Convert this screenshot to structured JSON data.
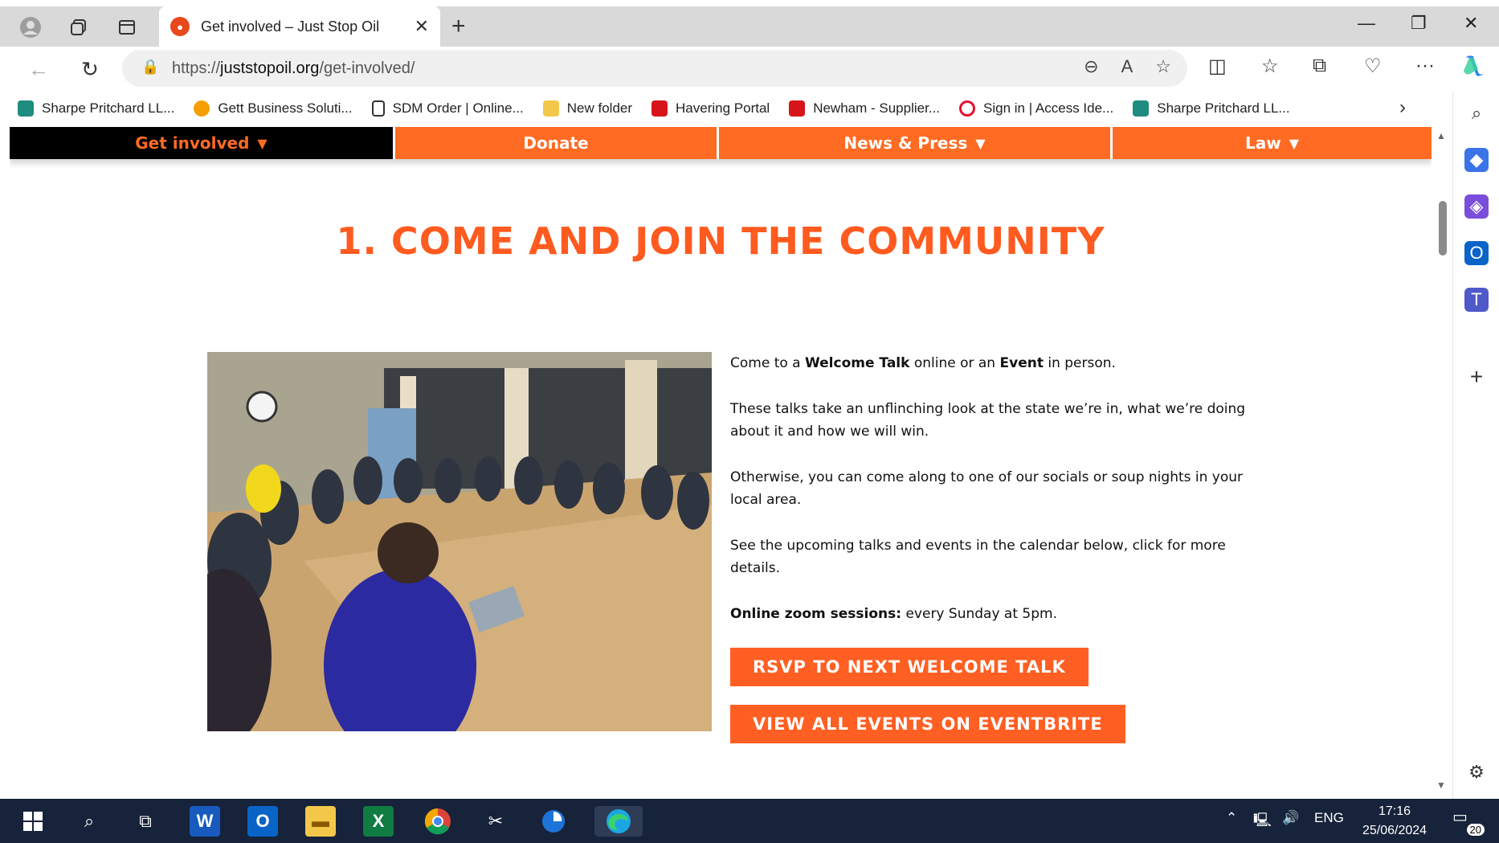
{
  "browser": {
    "tab_title": "Get involved – Just Stop Oil",
    "url_scheme": "https://",
    "url_host": "juststopoil.org",
    "url_path": "/get-involved/"
  },
  "bookmarks": [
    {
      "label": "Sharpe Pritchard LL...",
      "color": "#1e8c7e"
    },
    {
      "label": "Gett Business Soluti...",
      "color": "#f5a000"
    },
    {
      "label": "SDM Order | Online...",
      "color": "#ffffff"
    },
    {
      "label": "New folder",
      "color": "#f3c84a"
    },
    {
      "label": "Havering Portal",
      "color": "#d7141a"
    },
    {
      "label": "Newham - Supplier...",
      "color": "#d7141a"
    },
    {
      "label": "Sign in | Access Ide...",
      "color": "#e8112d"
    },
    {
      "label": "Sharpe Pritchard LL...",
      "color": "#1e8c7e"
    }
  ],
  "site_nav": [
    {
      "label": "Get involved",
      "has_menu": true,
      "active": true
    },
    {
      "label": "Donate",
      "has_menu": false,
      "active": false
    },
    {
      "label": "News & Press",
      "has_menu": true,
      "active": false
    },
    {
      "label": "Law",
      "has_menu": true,
      "active": false
    }
  ],
  "main": {
    "heading": "1. COME AND JOIN THE COMMUNITY",
    "p1_a": "Come to a ",
    "p1_b": "Welcome Talk",
    "p1_c": " online or an ",
    "p1_d": "Event",
    "p1_e": " in person.",
    "p2": "These talks take an unflinching look at the state we’re in, what we’re doing about it and how we will win.",
    "p3": "Otherwise, you can come along to one of our socials or soup nights in your local area.",
    "p4": "See the upcoming talks and events in the calendar below, click for more details.",
    "p5_label": "Online zoom sessions:",
    "p5_text": " every Sunday at 5pm.",
    "cta1": "RSVP TO NEXT WELCOME TALK",
    "cta2": "VIEW ALL EVENTS ON EVENTBRITE"
  },
  "taskbar": {
    "lang": "ENG",
    "time": "17:16",
    "date": "25/06/2024",
    "notifications": "20"
  },
  "colors": {
    "brand_orange": "#ff6b22",
    "nav_active_bg": "#000000"
  }
}
